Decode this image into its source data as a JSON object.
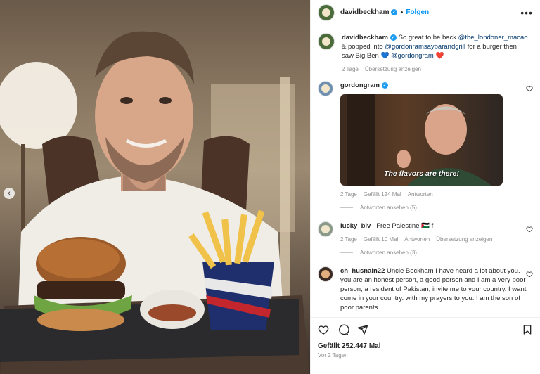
{
  "header": {
    "username": "davidbeckham",
    "separator": "•",
    "follow_label": "Folgen",
    "more_label": "•••"
  },
  "caption": {
    "username": "davidbeckham",
    "text_1": "So great to be back ",
    "mention_1": "@the_londoner_macao",
    "text_2": " & popped into ",
    "mention_2": "@gordonramsaybarandgrill",
    "text_3": " for a burger then saw Big Ben ",
    "emoji_1": "💙",
    "mention_3": "@gordongram",
    "emoji_2": "❤️",
    "time": "2 Tage",
    "translate": "Übersetzung anzeigen"
  },
  "comments": [
    {
      "username": "gordongram",
      "gif_caption": "The flavors are there!",
      "time": "2 Tage",
      "likes": "Gefällt 124 Mal",
      "reply": "Antworten",
      "view_replies": "Antworten ansehen (5)"
    },
    {
      "username": "lucky_blv_",
      "text": "Free Palestine 🇵🇸 f",
      "time": "2 Tage",
      "likes": "Gefällt 10 Mal",
      "reply": "Antworten",
      "translate": "Übersetzung anzeigen",
      "view_replies": "Antworten ansehen (3)"
    },
    {
      "username": "ch_husnain22",
      "text": "Uncle Beckham I have heard a lot about you. you are an honest person, a good person and I am a very poor person, a resident of Pakistan, invite me to your country. I want come in your country. with my prayers to you. I am the son of poor parents"
    }
  ],
  "footer": {
    "likes": "Gefällt 252.447 Mal",
    "date": "Vor 2 Tagen"
  },
  "photo": {
    "carousel_prev": "‹"
  },
  "colors": {
    "accent": "#0095f6",
    "verified": "#1d9bf0",
    "muted": "#8e8e8e"
  }
}
